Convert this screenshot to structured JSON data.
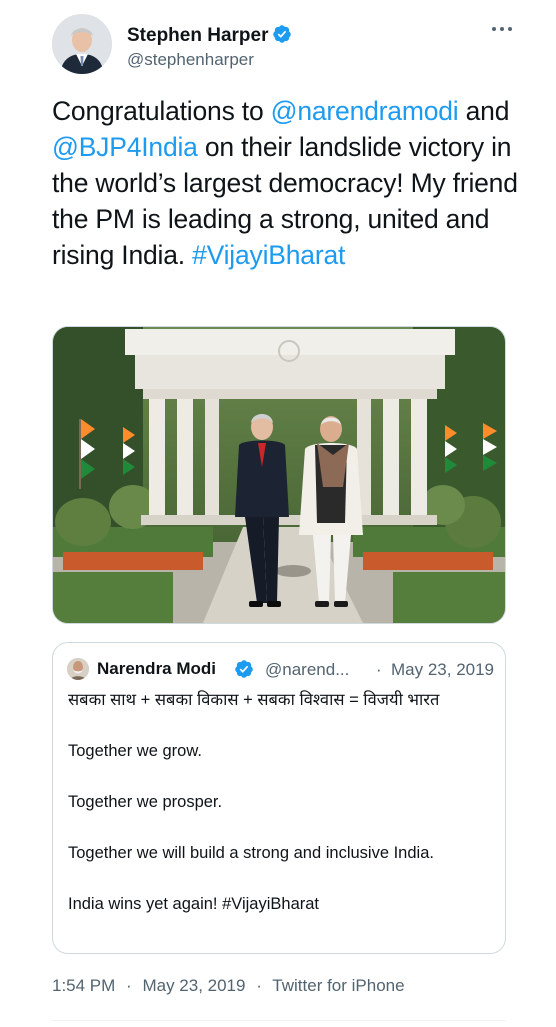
{
  "tweet": {
    "author_name": "Stephen Harper",
    "author_handle": "@stephenharper",
    "more_icon": "more-horizontal-icon",
    "text_segments": [
      {
        "text": "Congratulations to ",
        "link": false
      },
      {
        "text": "@narendramodi",
        "link": true
      },
      {
        "text": " and ",
        "link": false
      },
      {
        "text": "@BJP4India",
        "link": true
      },
      {
        "text": " on their landslide victory in the world’s largest democracy! My friend the PM is leading a strong, united and rising India. ",
        "link": false
      },
      {
        "text": "#VijayiBharat",
        "link": true
      }
    ],
    "timestamp": "1:54 PM",
    "date": "May 23, 2019",
    "source": "Twitter for iPhone",
    "separator": "·"
  },
  "quote": {
    "author_name": "Narendra Modi",
    "author_handle": "@narend...",
    "separator": "·",
    "date": "May 23, 2019",
    "lines": [
      "सबका साथ + सबका विकास + सबका विश्वास = विजयी भारत",
      "Together we grow.",
      "Together we prosper.",
      "Together we will build a strong and inclusive India.",
      "India wins yet again! #VijayiBharat"
    ]
  },
  "colors": {
    "link": "#1d9bf0",
    "verified": "#1d9bf0",
    "text": "#0f1419",
    "secondary": "#536471",
    "border": "#cfd9de"
  }
}
